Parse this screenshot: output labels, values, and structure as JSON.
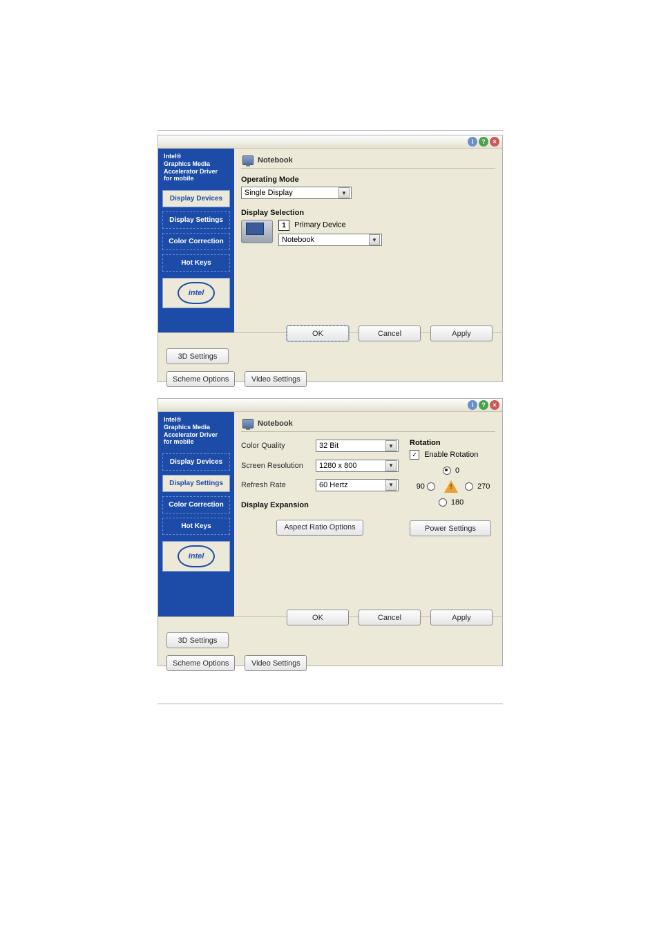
{
  "brand": {
    "line1": "Intel®",
    "line2": "Graphics Media",
    "line3": "Accelerator Driver",
    "line4": "for mobile"
  },
  "logo_text": "intel",
  "nav": {
    "display_devices": "Display Devices",
    "display_settings": "Display Settings",
    "color_correction": "Color Correction",
    "hot_keys": "Hot Keys"
  },
  "panel1": {
    "tab_title": "Notebook",
    "operating_mode_heading": "Operating Mode",
    "operating_mode_value": "Single Display",
    "display_selection_heading": "Display Selection",
    "primary_device_label": "Primary Device",
    "primary_device_value": "Notebook",
    "primary_device_number": "1"
  },
  "panel2": {
    "tab_title": "Notebook",
    "color_quality_label": "Color Quality",
    "color_quality_value": "32 Bit",
    "screen_resolution_label": "Screen Resolution",
    "screen_resolution_value": "1280 x 800",
    "refresh_rate_label": "Refresh Rate",
    "refresh_rate_value": "60 Hertz",
    "display_expansion_heading": "Display Expansion",
    "aspect_ratio_button": "Aspect Ratio Options",
    "rotation_heading": "Rotation",
    "enable_rotation_label": "Enable Rotation",
    "enable_rotation_checked": true,
    "rot_0": "0",
    "rot_90": "90",
    "rot_180": "180",
    "rot_270": "270",
    "rotation_selected": "0",
    "power_settings_button": "Power Settings"
  },
  "buttons": {
    "ok": "OK",
    "cancel": "Cancel",
    "apply": "Apply",
    "3d_settings": "3D Settings",
    "scheme_options": "Scheme Options",
    "video_settings": "Video Settings"
  },
  "titlebar_icons": {
    "info": "i",
    "help": "?",
    "close": "×"
  }
}
